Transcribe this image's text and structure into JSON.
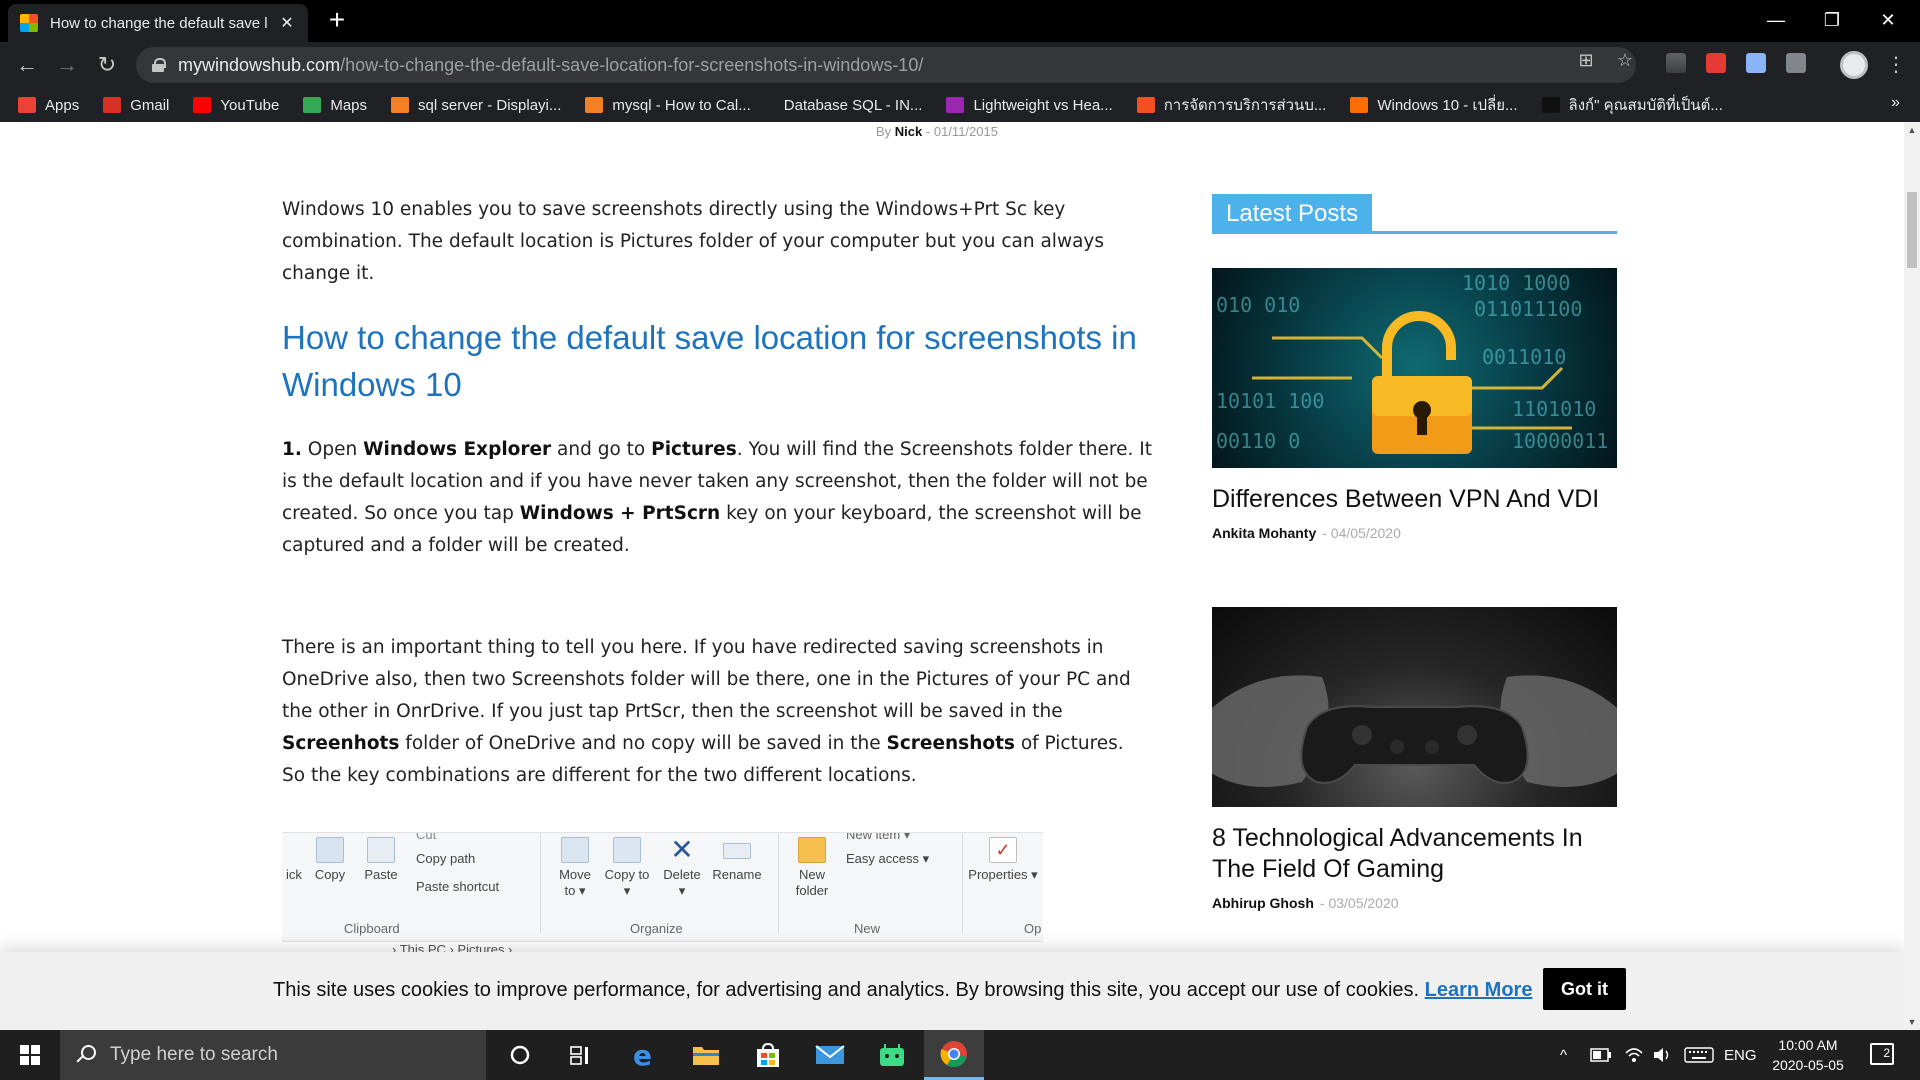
{
  "browser": {
    "tab_title": "How to change the default save l",
    "tab_close": "✕",
    "new_tab": "+",
    "url_host": "mywindowshub.com",
    "url_path": "/how-to-change-the-default-save-location-for-screenshots-in-windows-10/",
    "window_controls": {
      "minimize": "—",
      "restore": "❐",
      "close": "✕"
    },
    "nav": {
      "back": "←",
      "forward": "→",
      "reload": "↻"
    },
    "omnibox_icons": {
      "translate": "⊞",
      "star": "☆"
    },
    "menu": "⋮",
    "bookmarks": [
      {
        "label": "Apps",
        "color": "#ea4335"
      },
      {
        "label": "Gmail",
        "color": "#d93025"
      },
      {
        "label": "YouTube",
        "color": "#ff0000"
      },
      {
        "label": "Maps",
        "color": "#34a853"
      },
      {
        "label": "sql server - Displayi...",
        "color": "#f48024"
      },
      {
        "label": "mysql - How to Cal...",
        "color": "#f48024"
      },
      {
        "label": "Database SQL - IN...",
        "color": "#202124"
      },
      {
        "label": "Lightweight vs Hea...",
        "color": "#9c27b0"
      },
      {
        "label": "การจัดการบริการส่วนบ...",
        "color": "#f25022"
      },
      {
        "label": "Windows 10 - เปลี่ย...",
        "color": "#ff6d00"
      },
      {
        "label": "ลิงก์\" คุณสมบัติที่เป็นต์...",
        "color": "#111111"
      }
    ],
    "bookmarks_more": "»"
  },
  "article": {
    "byline_prefix": "By",
    "author": "Nick",
    "byline_sep": "-",
    "date": "01/11/2015",
    "intro": "Windows 10 enables you to save screenshots directly using the Windows+Prt Sc key combination. The default location is Pictures folder of your computer but you can always change it.",
    "heading": "How to change the default save location for screenshots in Windows 10",
    "step1": {
      "num": "1.",
      "t1": " Open ",
      "b1": "Windows Explorer",
      "t2": " and go to ",
      "b2": "Pictures",
      "t3": ". You will find the Screenshots folder there. It is the default location and if you have never taken any screenshot, then the folder will not be created. So once you tap ",
      "b3": "Windows + PrtScrn",
      "t4": " key on your keyboard, the screenshot will be captured and a folder will be created."
    },
    "para2": {
      "t1": "There is an important thing to tell you here. If you have redirected saving screenshots in OneDrive also, then two Screenshots folder will be there, one in the Pictures of your PC and the other in OnrDrive. If you just tap PrtScr, then the screenshot will be saved in the ",
      "b1": "Screenhots",
      "t2": " folder of OneDrive and no copy will be saved in the ",
      "b2": "Screenshots",
      "t3": " of Pictures. So the key combinations are different for the two different locations."
    },
    "ribbon": {
      "pin": "ick",
      "copy": "Copy",
      "paste": "Paste",
      "cut": "Cut",
      "copy_path": "Copy path",
      "paste_shortcut": "Paste shortcut",
      "move_to": "Move to ▾",
      "copy_to": "Copy to ▾",
      "delete": "Delete ▾",
      "rename": "Rename",
      "new_folder": "New folder",
      "new_item": "New item ▾",
      "easy_access": "Easy access ▾",
      "properties": "Properties ▾",
      "sec_clipboard": "Clipboard",
      "sec_organize": "Organize",
      "sec_new": "New",
      "sec_open": "Op",
      "address": "›  This PC  ›  Pictures  ›"
    }
  },
  "sidebar": {
    "title": "Latest Posts",
    "posts": [
      {
        "title": "Differences Between VPN And VDI",
        "author": "Ankita Mohanty",
        "date": "04/05/2020"
      },
      {
        "title": "8 Technological Advancements In The Field Of Gaming",
        "author": "Abhirup Ghosh",
        "date": "03/05/2020"
      }
    ],
    "meta_sep": "-"
  },
  "cookie": {
    "text": "This site uses cookies to improve performance, for advertising and analytics. By browsing this site, you accept our use of cookies. ",
    "link": "Learn More",
    "button": "Got it"
  },
  "taskbar": {
    "search_placeholder": "Type here to search",
    "lang": "ENG",
    "time": "10:00 AM",
    "date": "2020-05-05",
    "notifications": "2",
    "tray_up": "^"
  }
}
